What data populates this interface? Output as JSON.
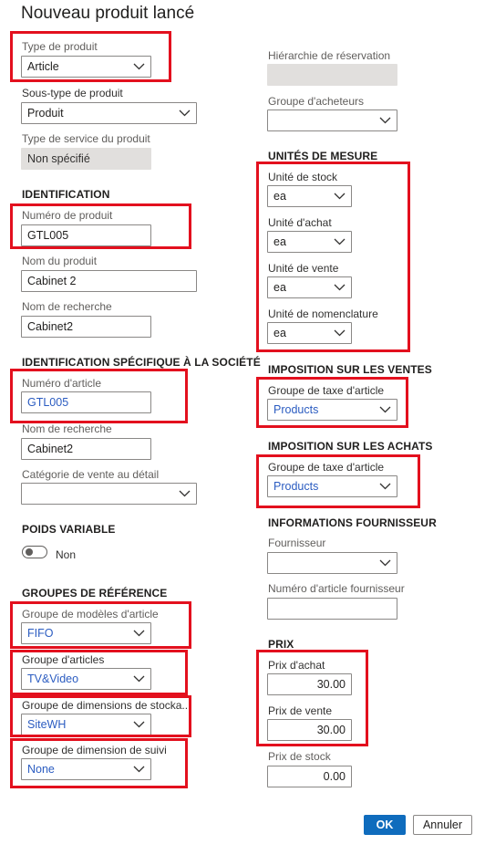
{
  "dialog": {
    "title": "Nouveau produit lancé"
  },
  "left": {
    "product_type": {
      "label": "Type de produit",
      "value": "Article"
    },
    "product_subtype": {
      "label": "Sous-type de produit",
      "value": "Produit"
    },
    "service_type": {
      "label": "Type de service du produit",
      "value": "Non spécifié"
    },
    "identification": {
      "header": "IDENTIFICATION",
      "product_number": {
        "label": "Numéro de produit",
        "value": "GTL005"
      },
      "product_name": {
        "label": "Nom du produit",
        "value": "Cabinet 2"
      },
      "search_name": {
        "label": "Nom de recherche",
        "value": "Cabinet2"
      }
    },
    "company_identification": {
      "header": "IDENTIFICATION SPÉCIFIQUE À LA SOCIÉTÉ",
      "item_number": {
        "label": "Numéro d'article",
        "value": "GTL005"
      },
      "search_name": {
        "label": "Nom de recherche",
        "value": "Cabinet2"
      },
      "retail_category": {
        "label": "Catégorie de vente au détail",
        "value": ""
      }
    },
    "variable_weight": {
      "header": "POIDS VARIABLE",
      "toggle_label": "Non"
    },
    "reference_groups": {
      "header": "GROUPES DE RÉFÉRENCE",
      "item_model_group": {
        "label": "Groupe de modèles d'article",
        "value": "FIFO"
      },
      "item_group": {
        "label": "Groupe d'articles",
        "value": "TV&Video"
      },
      "storage_dimension_group": {
        "label": "Groupe de dimensions de stocka...",
        "value": "SiteWH"
      },
      "tracking_dimension_group": {
        "label": "Groupe de dimension de suivi",
        "value": "None"
      }
    }
  },
  "right": {
    "reservation_hierarchy": {
      "label": "Hiérarchie de réservation",
      "value": ""
    },
    "buyer_group": {
      "label": "Groupe d'acheteurs",
      "value": ""
    },
    "units": {
      "header": "UNITÉS DE MESURE",
      "inventory_unit": {
        "label": "Unité de stock",
        "value": "ea"
      },
      "purchase_unit": {
        "label": "Unité d'achat",
        "value": "ea"
      },
      "sales_unit": {
        "label": "Unité de vente",
        "value": "ea"
      },
      "bom_unit": {
        "label": "Unité de nomenclature",
        "value": "ea"
      }
    },
    "sales_tax": {
      "header": "IMPOSITION SUR LES VENTES",
      "item_tax_group": {
        "label": "Groupe de taxe d'article",
        "value": "Products"
      }
    },
    "purchase_tax": {
      "header": "IMPOSITION SUR LES ACHATS",
      "item_tax_group": {
        "label": "Groupe de taxe d'article",
        "value": "Products"
      }
    },
    "vendor_info": {
      "header": "INFORMATIONS FOURNISSEUR",
      "vendor": {
        "label": "Fournisseur",
        "value": ""
      },
      "vendor_item_number": {
        "label": "Numéro d'article fournisseur",
        "value": ""
      }
    },
    "price": {
      "header": "PRIX",
      "purchase_price": {
        "label": "Prix d'achat",
        "value": "30.00"
      },
      "sales_price": {
        "label": "Prix de vente",
        "value": "30.00"
      },
      "cost_price": {
        "label": "Prix de stock",
        "value": "0.00"
      }
    }
  },
  "buttons": {
    "ok": "OK",
    "cancel": "Annuler"
  },
  "icons": {
    "dropdown": "chevron-down-icon"
  },
  "colors": {
    "highlight": "#e3101e",
    "primary": "#0f6cbd",
    "link_value": "#2b5cc1",
    "readonly_bg": "#e1dfdd"
  }
}
